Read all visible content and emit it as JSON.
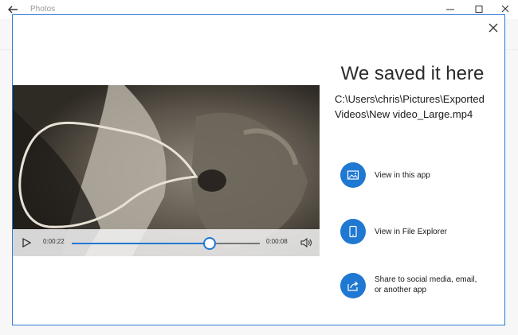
{
  "app": {
    "title": "Photos"
  },
  "dialog": {
    "heading": "We saved it here",
    "path_line1": "C:\\Users\\chris\\Pictures\\Exported",
    "path_line2": "Videos\\New video_Large.mp4"
  },
  "player": {
    "elapsed": "0:00:22",
    "remaining": "0:00:08",
    "progress_fraction": 0.73
  },
  "actions": [
    {
      "label": "View in this app",
      "icon": "image-icon"
    },
    {
      "label": "View in File Explorer",
      "icon": "phone-icon"
    },
    {
      "label_line1": "Share to social media, email,",
      "label_line2": "or another app",
      "icon": "share-icon"
    }
  ],
  "colors": {
    "accent": "#1f78d1",
    "dialog_border": "#2b7bd6"
  }
}
